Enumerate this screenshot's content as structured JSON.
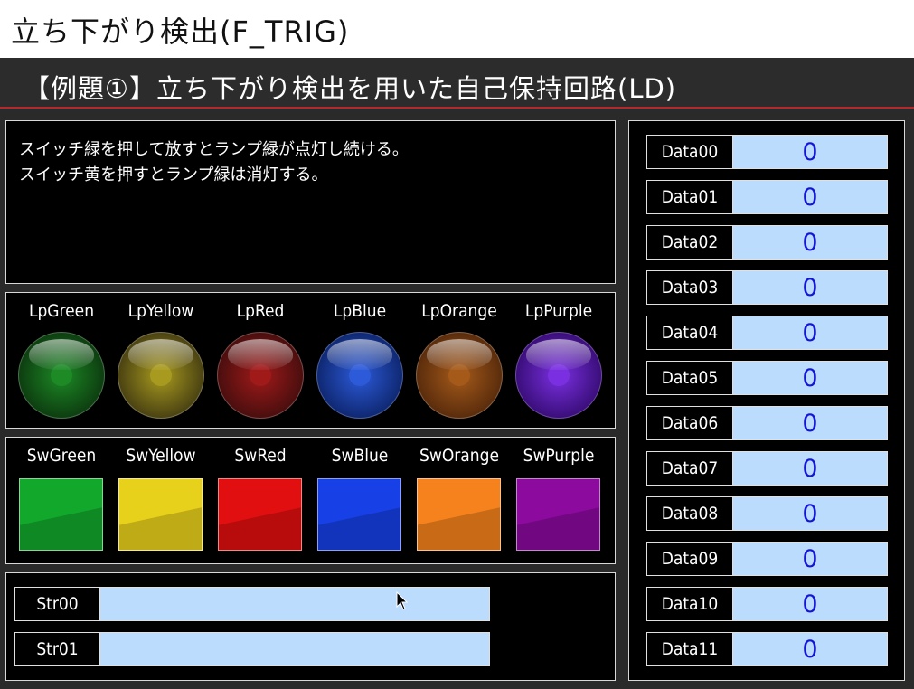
{
  "title": "立ち下がり検出(F_TRIG)",
  "subtitle": "【例題①】立ち下がり検出を用いた自己保持回路(LD)",
  "description": {
    "line1": "スイッチ緑を押して放すとランプ緑が点灯し続ける。",
    "line2": "スイッチ黄を押すとランプ緑は消灯する。"
  },
  "lamps": [
    {
      "label": "LpGreen",
      "color": "#0d3d10",
      "core": "#1d8a26"
    },
    {
      "label": "LpYellow",
      "color": "#4a4212",
      "core": "#a89a1f"
    },
    {
      "label": "LpRed",
      "color": "#4a0e0e",
      "core": "#a01a1a"
    },
    {
      "label": "LpBlue",
      "color": "#0f2872",
      "core": "#2c5ad8"
    },
    {
      "label": "LpOrange",
      "color": "#5a2c0c",
      "core": "#a55a1a"
    },
    {
      "label": "LpPurple",
      "color": "#3a0e7a",
      "core": "#7a30e0"
    }
  ],
  "switches": [
    {
      "label": "SwGreen",
      "color": "#12a82c"
    },
    {
      "label": "SwYellow",
      "color": "#e8d11a"
    },
    {
      "label": "SwRed",
      "color": "#e10f0f"
    },
    {
      "label": "SwBlue",
      "color": "#1740e6"
    },
    {
      "label": "SwOrange",
      "color": "#f5821c"
    },
    {
      "label": "SwPurple",
      "color": "#8c0a9e"
    }
  ],
  "strings": [
    {
      "label": "Str00",
      "value": ""
    },
    {
      "label": "Str01",
      "value": ""
    }
  ],
  "data": [
    {
      "label": "Data00",
      "value": "0"
    },
    {
      "label": "Data01",
      "value": "0"
    },
    {
      "label": "Data02",
      "value": "0"
    },
    {
      "label": "Data03",
      "value": "0"
    },
    {
      "label": "Data04",
      "value": "0"
    },
    {
      "label": "Data05",
      "value": "0"
    },
    {
      "label": "Data06",
      "value": "0"
    },
    {
      "label": "Data07",
      "value": "0"
    },
    {
      "label": "Data08",
      "value": "0"
    },
    {
      "label": "Data09",
      "value": "0"
    },
    {
      "label": "Data10",
      "value": "0"
    },
    {
      "label": "Data11",
      "value": "0"
    }
  ]
}
